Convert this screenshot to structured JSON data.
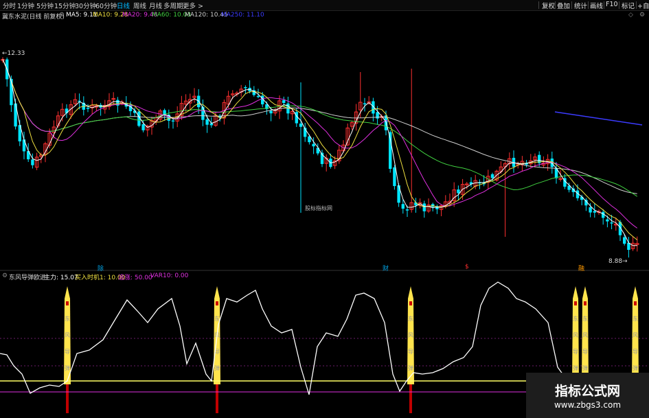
{
  "period_tabs": [
    "分时",
    "1分钟",
    "5分钟",
    "15分钟",
    "30分钟",
    "60分钟",
    "日线",
    "周线",
    "月线",
    "多周期",
    "更多"
  ],
  "active_period": "日线",
  "right_toolbar": [
    "复权",
    "叠加",
    "统计",
    "画线",
    "F10",
    "标记",
    "+自选"
  ],
  "stock": {
    "title": "冀东水泥(日线 前复权)",
    "ma": [
      {
        "text": "MA5: 9.11",
        "color": "#ffffff"
      },
      {
        "text": "MA10: 9.28",
        "color": "#f0e040"
      },
      {
        "text": "MA20: 9.48",
        "color": "#e030e0"
      },
      {
        "text": "MA60: 10.03",
        "color": "#40d040"
      },
      {
        "text": "MA120: 10.45",
        "color": "#cfcfcf"
      },
      {
        "text": "MA250: 11.10",
        "color": "#3b3bff"
      }
    ]
  },
  "price_high_label": "12.33",
  "price_low_label": "8.88",
  "event_markers": [
    {
      "text": "除",
      "color": "#00a0e0"
    },
    {
      "text": "财",
      "color": "#00a0e0"
    },
    {
      "text": "$",
      "color": "#ff3030"
    },
    {
      "text": "融",
      "color": "#ff9900"
    }
  ],
  "small_watermark": "股标指标网",
  "indicator": {
    "name": "东风导弹欧进",
    "items": [
      {
        "text": "主力: 15.07",
        "color": "#ffffff"
      },
      {
        "text": "买入时机1: 10.00",
        "color": "#f0e040"
      },
      {
        "text": "追涨: 50.00",
        "color": "#e030e0"
      },
      {
        "text": "VAR10: 0.00",
        "color": "#e030e0"
      }
    ],
    "missile_text": [
      "东",
      "风",
      "导",
      "弹"
    ]
  },
  "watermark": {
    "title": "指标公式网",
    "url": "www.zbgs3.com"
  },
  "colors": {
    "up": "#ff3030",
    "down": "#00e5ff",
    "ma5": "#ffffff",
    "ma10": "#f0e040",
    "ma20": "#e030e0",
    "ma60": "#40d040",
    "ma120": "#cfcfcf",
    "ma250": "#3b3bff",
    "missile": "#ffe44d"
  }
}
